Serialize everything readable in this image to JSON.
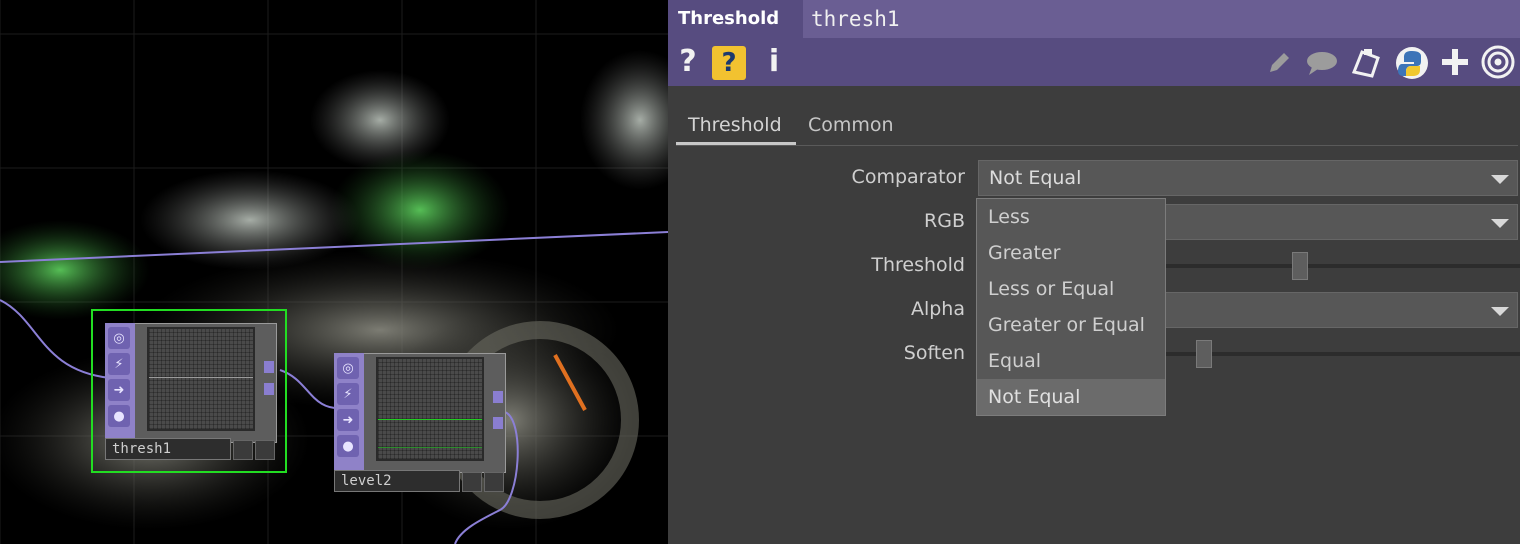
{
  "network": {
    "nodes": [
      {
        "name": "thresh1"
      },
      {
        "name": "level2"
      }
    ]
  },
  "panel": {
    "op_type": "Threshold",
    "op_name": "thresh1",
    "toolbar": {
      "help": "?",
      "help_python": "?",
      "info": "i",
      "icons": [
        "pencil-icon",
        "comment-icon",
        "clipboard-icon",
        "python-icon",
        "plus-icon",
        "target-icon"
      ]
    },
    "tabs": [
      {
        "label": "Threshold",
        "active": true
      },
      {
        "label": "Common",
        "active": false
      }
    ],
    "params": {
      "comparator": {
        "label": "Comparator",
        "value": "Not Equal"
      },
      "rgb": {
        "label": "RGB"
      },
      "threshold": {
        "label": "Threshold",
        "level": 0.5
      },
      "alpha": {
        "label": "Alpha"
      },
      "soften": {
        "label": "Soften",
        "level": 0.05
      }
    },
    "dropdown": {
      "options": [
        "Less",
        "Greater",
        "Less or Equal",
        "Greater or Equal",
        "Equal",
        "Not Equal"
      ],
      "selected": "Not Equal"
    }
  },
  "colors": {
    "title_bg": "#6a5e93",
    "toolbar_bg": "#574c80",
    "panel_bg": "#3d3d3d",
    "selection_outline": "#22dd22",
    "wire": "#8b7fd6"
  }
}
